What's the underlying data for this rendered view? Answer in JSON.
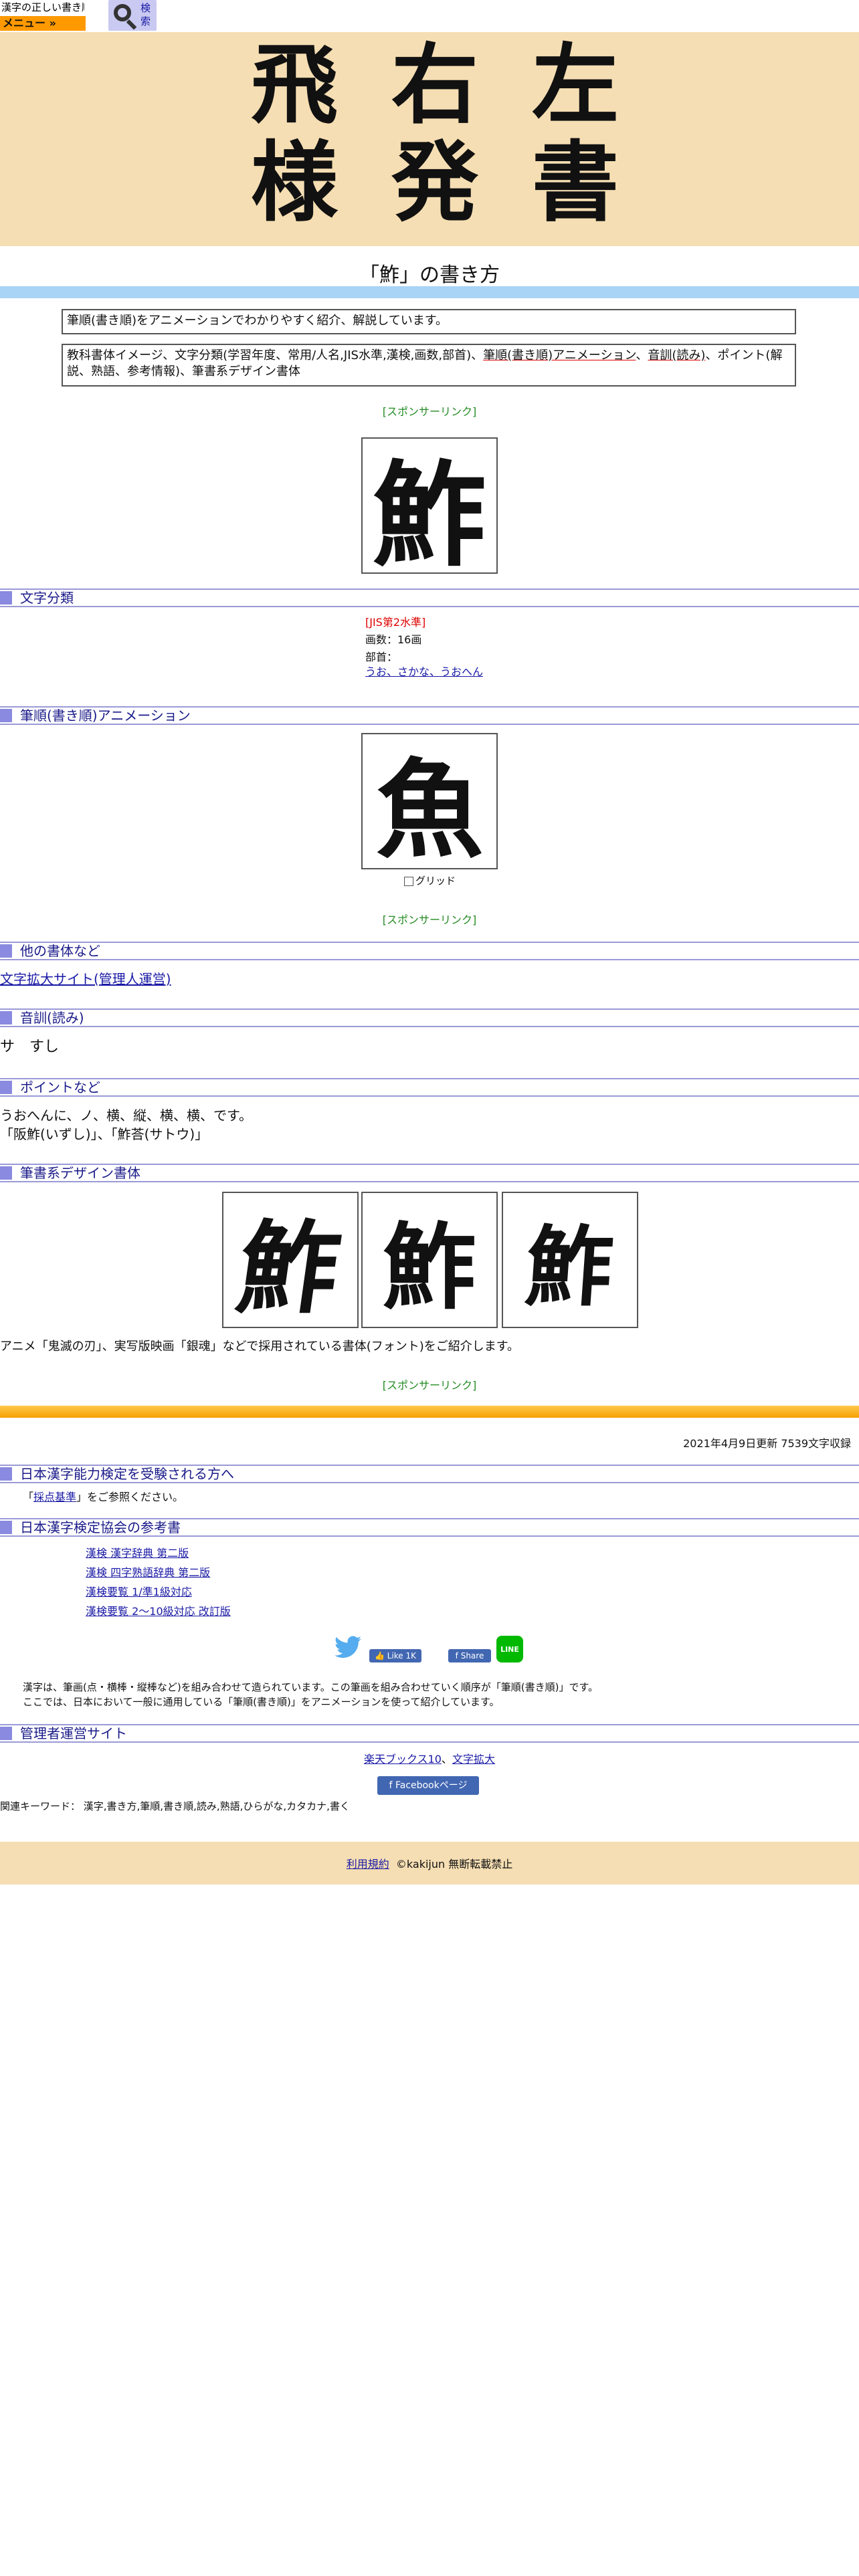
{
  "header": {
    "logo_text": "漢字の正しい書き順(筆順)",
    "menu_label": "メニュー »",
    "search_label": "検索"
  },
  "banner": {
    "row1": [
      "飛",
      "右",
      "左"
    ],
    "row2": [
      "様",
      "発",
      "書"
    ]
  },
  "page_title": "「鮓」の書き方",
  "intro": {
    "line1": "筆順(書き順)をアニメーションでわかりやすく紹介、解説しています。",
    "line2_prefix": "教科書体イメージ、文字分類(学習年度、常用/人名,JIS水準,漢検,画数,部首)、",
    "line2_link1": "筆順(書き順)アニメーション",
    "line2_sep": "、",
    "line2_link2": "音訓(読み)",
    "line2_suffix": "、ポイント(解説、熟語、参考情報)、筆書系デザイン書体"
  },
  "sponsor_label": "[スポンサーリンク]",
  "main_kanji": "鮓",
  "sections": {
    "classification": "文字分類",
    "animation": "筆順(書き順)アニメーション",
    "other_fonts": "他の書体など",
    "reading": "音訓(読み)",
    "points": "ポイントなど",
    "design_fonts": "筆書系デザイン書体",
    "kentei": "日本漢字能力検定を受験される方へ",
    "references": "日本漢字検定協会の参考書",
    "admin_sites": "管理者運営サイト"
  },
  "classification": {
    "jis": "[JIS第2水準]",
    "strokes": "画数：16画",
    "radical_label": "部首：",
    "radical_value": "うお、さかな、うおへん"
  },
  "animation": {
    "glyph": "魚",
    "grid_label": "グリッド"
  },
  "other_fonts": {
    "link": "文字拡大サイト(管理人運営)"
  },
  "reading": {
    "value": "サ　すし"
  },
  "points": {
    "line1": "うおへんに、ノ、横、縦、横、横、です。",
    "line2": "「阪鮓(いずし)」、「鮓荅(サトウ)」"
  },
  "design_fonts": {
    "glyphs": [
      "鮓",
      "鮓",
      "鮓"
    ],
    "caption": "アニメ「鬼滅の刃」、実写版映画「銀魂」などで採用されている書体(フォント)をご紹介します。"
  },
  "update_info": "2021年4月9日更新 7539文字収録",
  "kentei": {
    "text_prefix": "「",
    "link": "採点基準",
    "text_suffix": "」をご参照ください。"
  },
  "references": [
    "漢検 漢字辞典 第二版",
    "漢検 四字熟語辞典 第二版",
    "漢検要覧 1/準1級対応",
    "漢検要覧 2～10級対応 改訂版"
  ],
  "social": {
    "like": "Like 1K",
    "share": "Share",
    "line": "LINE"
  },
  "about": {
    "line1": "漢字は、筆画(点・横棒・縦棒など)を組み合わせて造られています。この筆画を組み合わせていく順序が「筆順(書き順)」です。",
    "line2": "ここでは、日本において一般に通用している「筆順(書き順)」をアニメーションを使って紹介しています。"
  },
  "admin_sites": {
    "link1": "楽天ブックス10",
    "sep": "、",
    "link2": "文字拡大",
    "fb_page": "Facebookページ"
  },
  "keywords": "関連キーワード： 漢字,書き方,筆順,書き順,読み,熟語,ひらがな,カタカナ,書く",
  "footer": {
    "terms": "利用規約",
    "copyright": "©kakijun 無断転載禁止"
  }
}
